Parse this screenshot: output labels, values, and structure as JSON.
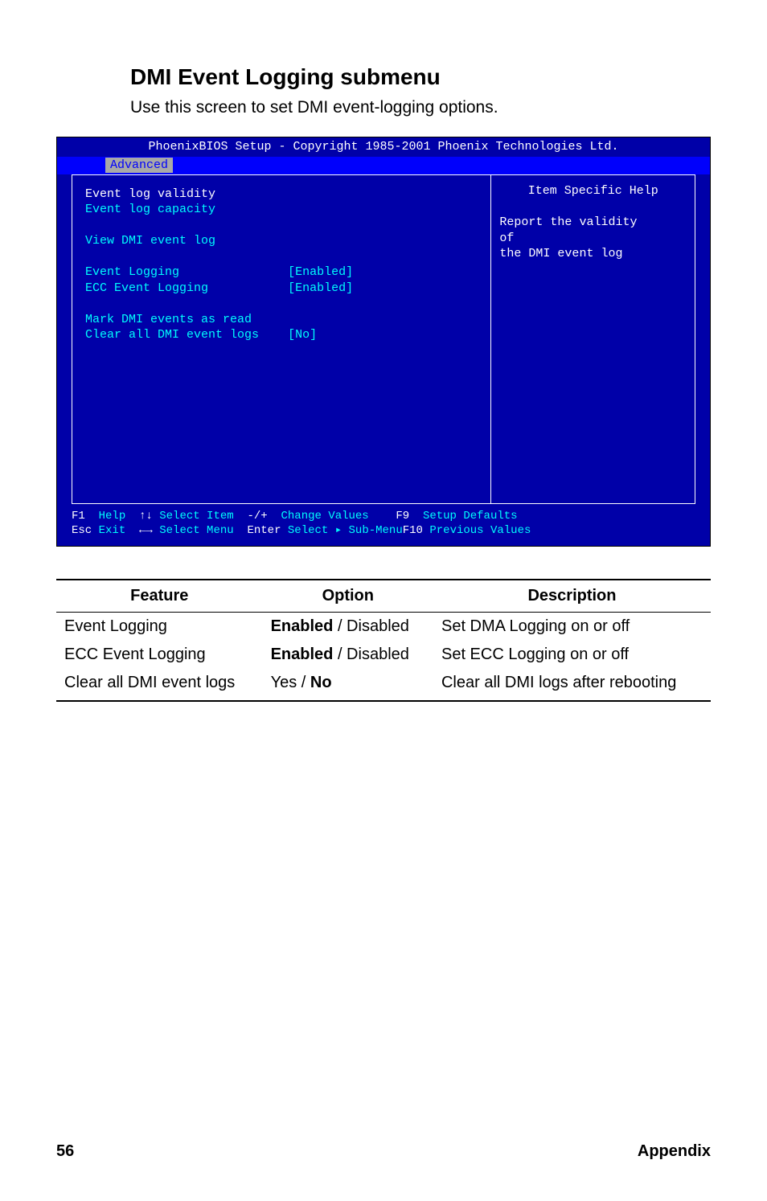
{
  "heading": "DMI Event Logging submenu",
  "subheading": "Use this screen to set DMI event-logging options.",
  "bios": {
    "title": "PhoenixBIOS Setup - Copyright 1985-2001 Phoenix Technologies Ltd.",
    "active_tab": "Advanced",
    "left": {
      "row_selected": "Event log validity",
      "row_capacity": "Event log capacity",
      "row_view": "View DMI event log",
      "row_logging": "Event Logging",
      "row_logging_val": "[Enabled]",
      "row_ecc": "ECC Event Logging",
      "row_ecc_val": "[Enabled]",
      "row_mark": "Mark DMI events as read",
      "row_clear": "Clear all DMI event logs",
      "row_clear_val": "[No]"
    },
    "help": {
      "title": "Item Specific Help",
      "body": "Report the validity\nof\nthe DMI event log"
    },
    "footer": {
      "line1_k1": "F1",
      "line1_t1": "  Help  ",
      "line1_k2": "↑↓",
      "line1_t2": " Select Item  ",
      "line1_k3": "-/+",
      "line1_t3": "  Change Values    ",
      "line1_k4": "F9",
      "line1_t4": "  Setup Defaults",
      "line2_k1": "Esc",
      "line2_t1": " Exit  ",
      "line2_k2": "←→",
      "line2_t2": " Select Menu  ",
      "line2_k3": "Enter",
      "line2_t3": " Select ▸ Sub-Menu",
      "line2_k4": "F10",
      "line2_t4": " Previous Values"
    }
  },
  "table": {
    "h1": "Feature",
    "h2": "Option",
    "h3": "Description",
    "r1c1": "Event Logging",
    "r1c2a": "Enabled",
    "r1c2b": " / Disabled",
    "r1c3": "Set DMA Logging on or off",
    "r2c1": "ECC Event Logging",
    "r2c2a": "Enabled",
    "r2c2b": " / Disabled",
    "r2c3": "Set ECC Logging on or off",
    "r3c1": "Clear all DMI event logs",
    "r3c2a": "Yes / ",
    "r3c2b": "No",
    "r3c3": "Clear all DMI logs after rebooting"
  },
  "footer": {
    "page": "56",
    "label": "Appendix"
  }
}
